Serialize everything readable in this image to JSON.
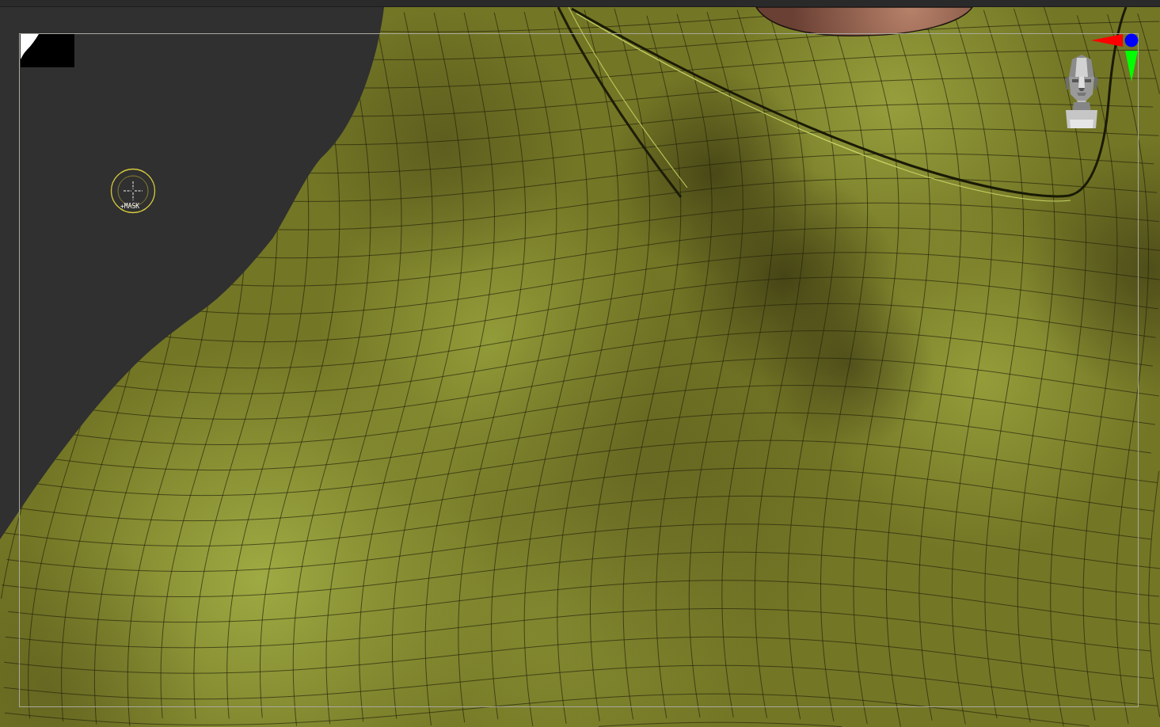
{
  "viewport": {
    "brush_cursor": {
      "label": "+MASK"
    }
  }
}
